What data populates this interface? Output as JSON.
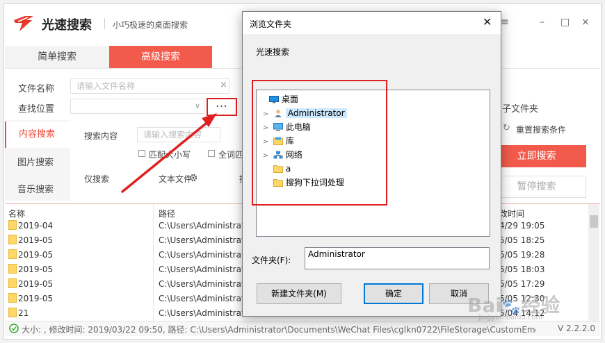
{
  "app": {
    "name": "光速搜索",
    "slogan": "小巧极速的桌面搜索",
    "tabs": [
      "简单搜索",
      "高级搜索"
    ],
    "menu_icon": "≡",
    "minimize_icon": "–",
    "maximize_icon": "□",
    "close_icon": "×"
  },
  "form": {
    "filename_label": "文件名称",
    "filename_placeholder": "请输入文件名称",
    "clear_icon": "×",
    "location_label": "查找位置",
    "location_dropdown": "∨",
    "more_button": "···",
    "subfolder_text": "子文件夹",
    "content_label": "搜索内容",
    "content_placeholder": "请输入搜索内容",
    "match_case": "匹配大小写",
    "whole_word": "全词匹",
    "only_search_label": "仅搜索",
    "text_file": "文本文件",
    "partial_char": "搜",
    "reset_icon": "↻",
    "reset_label": "重置搜索条件",
    "search_button": "立即搜索",
    "pause_button": "暂停搜索"
  },
  "sidebar": {
    "items": [
      "内容搜索",
      "图片搜索",
      "音乐搜索"
    ]
  },
  "results": {
    "col_name": "名称",
    "col_path": "路径",
    "col_time": "改时间",
    "rows": [
      {
        "name": "2019-04",
        "path": "C:\\Users\\Administrato",
        "time": "4/29 19:05"
      },
      {
        "name": "2019-05",
        "path": "C:\\Users\\Administrato",
        "time": "5/05 18:25"
      },
      {
        "name": "2019-05",
        "path": "C:\\Users\\Administrato",
        "time": "5/05 19:28"
      },
      {
        "name": "2019-05",
        "path": "C:\\Users\\Administrato",
        "time": "5/05 18:03"
      },
      {
        "name": "2019-05",
        "path": "C:\\Users\\Administrato",
        "time": "5/05 17:29"
      },
      {
        "name": "2019-05",
        "path": "C:\\Users\\Administrato",
        "time": "5/05 12:30"
      },
      {
        "name": "21",
        "path": "C:\\Users\\Administrato",
        "time": "5/04 14:12"
      }
    ]
  },
  "status": {
    "text": "大小: , 修改时间: 2019/03/22 09:50, 路径: C:\\Users\\Administrator\\Documents\\WeChat Files\\cglkn0722\\FileStorage\\CustomEmotio",
    "version": "V 2.2.2.0"
  },
  "dialog": {
    "title": "浏览文件夹",
    "close_icon": "✕",
    "description": "光速搜索",
    "tree": [
      {
        "label": "桌面",
        "icon": "desktop-icon",
        "has_children": false,
        "level": 0
      },
      {
        "label": "Administrator",
        "icon": "user-icon",
        "has_children": true,
        "level": 1,
        "selected": true
      },
      {
        "label": "此电脑",
        "icon": "computer-icon",
        "has_children": true,
        "level": 1
      },
      {
        "label": "库",
        "icon": "library-icon",
        "has_children": true,
        "level": 1
      },
      {
        "label": "网络",
        "icon": "network-icon",
        "has_children": true,
        "level": 1
      },
      {
        "label": "a",
        "icon": "folder-icon",
        "has_children": false,
        "level": 1
      },
      {
        "label": "搜狗下拉词处理",
        "icon": "folder-icon",
        "has_children": false,
        "level": 1
      }
    ],
    "folder_label": "文件夹(F):",
    "folder_value": "Administrator",
    "new_folder_button": "新建文件夹(M)",
    "ok_button": "确定",
    "cancel_button": "取消"
  },
  "watermark": {
    "text": "Bai",
    "text2": "经验",
    "sub": "jingyan.baidu.com"
  },
  "colors": {
    "accent": "#f25b4b",
    "annotation": "#e02020",
    "selection": "#cce8ff"
  }
}
